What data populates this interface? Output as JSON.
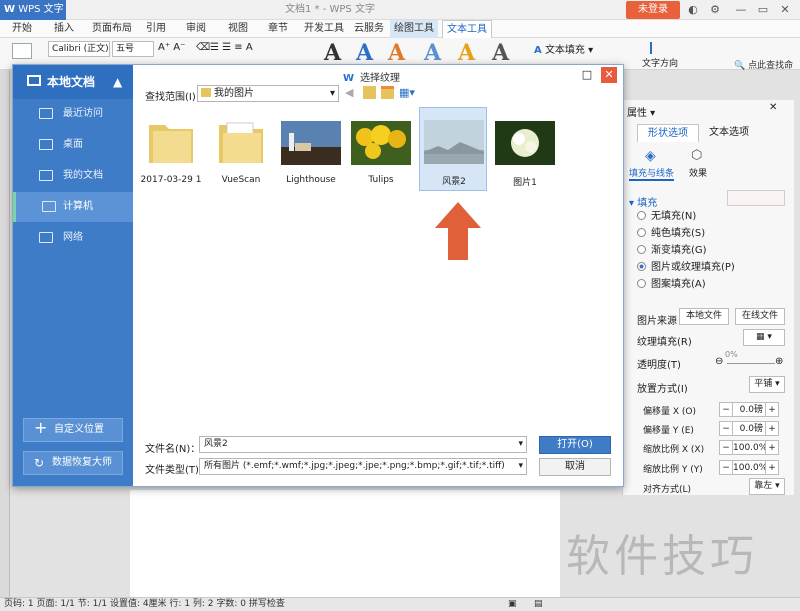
{
  "titlebar": {
    "app": "WPS 文字",
    "document": "文档1 * - WPS 文字",
    "login": "未登录"
  },
  "menu": [
    "开始",
    "插入",
    "页面布局",
    "引用",
    "审阅",
    "视图",
    "章节",
    "开发工具",
    "云服务",
    "绘图工具",
    "文本工具"
  ],
  "ribbon": {
    "font": "Calibri (正文)",
    "size": "五号",
    "text_fill": "文本填充",
    "text_direction": "文字方向",
    "search": "点此查找命令"
  },
  "dialog": {
    "title": "选择纹理",
    "sidebar": {
      "head": "本地文档",
      "items": [
        "最近访问",
        "桌面",
        "我的文档",
        "计算机",
        "网络"
      ],
      "custom_location": "自定义位置",
      "recovery": "数据恢复大师"
    },
    "lookin_label": "查找范围(I)：",
    "lookin_value": "我的图片",
    "files": [
      {
        "name": "2017-03-29 1",
        "kind": "folder"
      },
      {
        "name": "VueScan",
        "kind": "folder"
      },
      {
        "name": "Lighthouse",
        "kind": "image"
      },
      {
        "name": "Tulips",
        "kind": "image"
      },
      {
        "name": "风景2",
        "kind": "image",
        "selected": true
      },
      {
        "name": "图片1",
        "kind": "image"
      }
    ],
    "filename_label": "文件名(N)：",
    "filename_value": "风景2",
    "filetype_label": "文件类型(T)：",
    "filetype_value": "所有图片 (*.emf;*.wmf;*.jpg;*.jpeg;*.jpe;*.png;*.bmp;*.gif;*.tif;*.tiff)",
    "open": "打开(O)",
    "cancel": "取消"
  },
  "panel": {
    "title": "属性",
    "tabs": [
      "形状选项",
      "文本选项"
    ],
    "subtabs": [
      "填充与线条",
      "效果"
    ],
    "fill_section": "填充",
    "fill_options": [
      "无填充(N)",
      "纯色填充(S)",
      "渐变填充(G)",
      "图片或纹理填充(P)",
      "图案填充(A)"
    ],
    "fill_selected": 3,
    "source_label": "图片来源",
    "local_file": "本地文件",
    "online_file": "在线文件",
    "texture_label": "纹理填充(R)",
    "transparency_label": "透明度(T)",
    "transparency_value": "0%",
    "placement_label": "放置方式(I)",
    "placement_value": "平铺",
    "offset_x_label": "偏移量 X (O)",
    "offset_x": "0.0磅",
    "offset_y_label": "偏移量 Y (E)",
    "offset_y": "0.0磅",
    "scale_x_label": "缩放比例 X (X)",
    "scale_x": "100.0%",
    "scale_y_label": "缩放比例 Y (Y)",
    "scale_y": "100.0%",
    "align_label": "对齐方式(L)",
    "align_value": "靠左"
  },
  "status": "页码: 1  页面: 1/1  节: 1/1  设置值: 4厘米  行: 1  列: 2  字数: 0  拼写检查",
  "watermark": "软件技巧",
  "colors": {
    "accent": "#3f7cc7",
    "arrow": "#e0603a",
    "login": "#e9613a"
  }
}
